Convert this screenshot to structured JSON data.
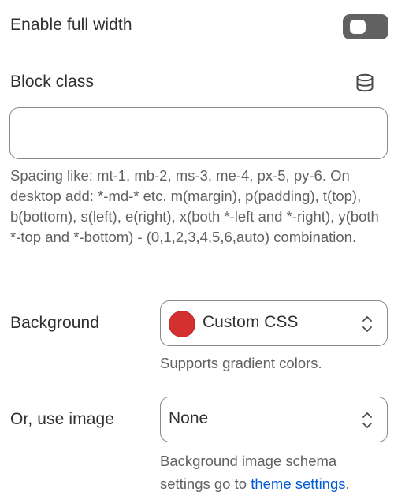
{
  "full_width": {
    "label": "Enable full width",
    "enabled": false
  },
  "block_class": {
    "label": "Block class",
    "icon": "database-icon",
    "value": "",
    "help": "Spacing like: mt-1, mb-2, ms-3, me-4, px-5, py-6. On desktop add: *-md-* etc. m(margin), p(padding), t(top), b(bottom), s(left), e(right), x(both *-left and *-right), y(both *-top and *-bottom) - (0,1,2,3,4,5,6,auto) combination."
  },
  "background": {
    "label": "Background",
    "swatch_color": "#d3302f",
    "selected": "Custom CSS",
    "hint": "Supports gradient colors."
  },
  "image": {
    "label": "Or, use image",
    "selected": "None",
    "hint_prefix": "Background image schema settings go to ",
    "hint_link": "theme settings",
    "hint_suffix": "."
  }
}
